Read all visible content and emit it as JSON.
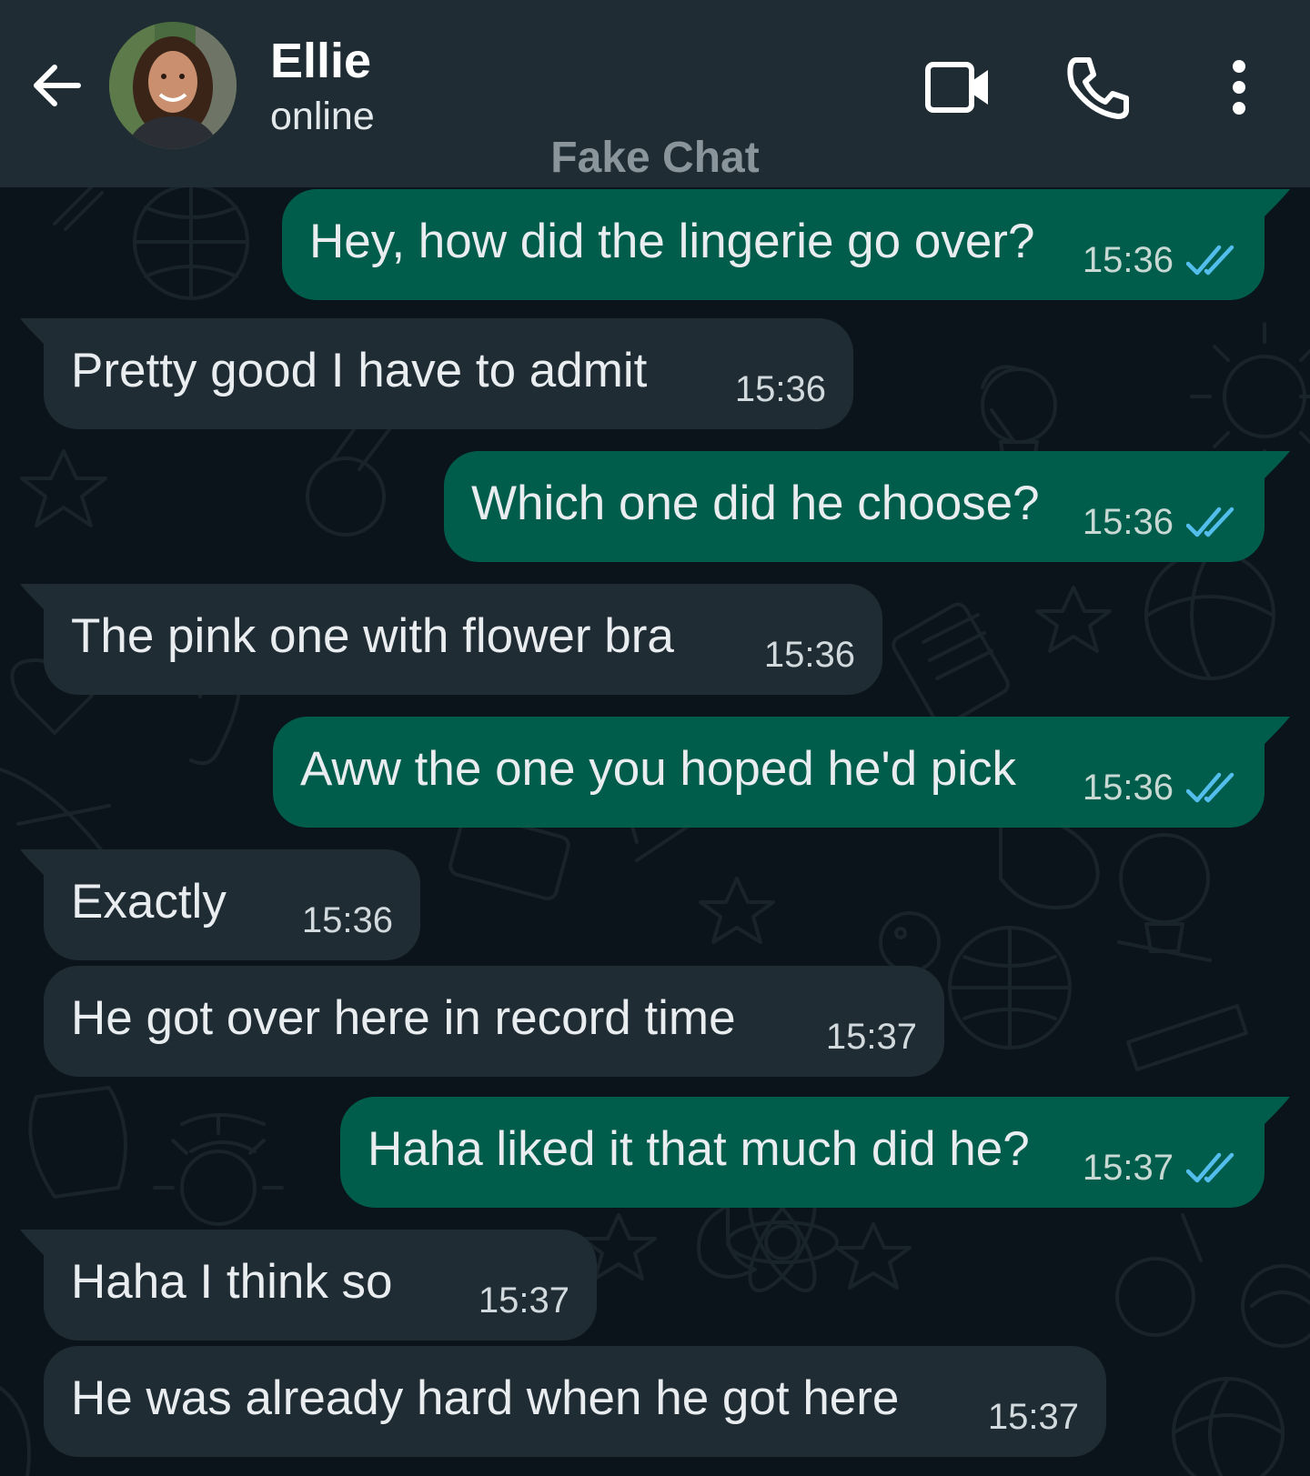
{
  "header": {
    "back_icon": "arrow-left-icon",
    "contact_name": "Ellie",
    "status": "online",
    "video_icon": "video-call-icon",
    "call_icon": "phone-icon",
    "menu_icon": "more-vertical-icon",
    "watermark": "Fake Chat"
  },
  "colors": {
    "header_bg": "#1f2c34",
    "chat_bg": "#0b141a",
    "outgoing_bubble": "#005c4b",
    "incoming_bubble": "#1f2c34",
    "read_ticks": "#53bdeb"
  },
  "messages": [
    {
      "direction": "outgoing",
      "text": "Hey, how did the lingerie go over?",
      "time": "15:36",
      "status": "read"
    },
    {
      "direction": "incoming",
      "text": "Pretty good I have to admit",
      "time": "15:36"
    },
    {
      "direction": "outgoing",
      "text": "Which one did he choose?",
      "time": "15:36",
      "status": "read"
    },
    {
      "direction": "incoming",
      "text": "The pink one with flower bra",
      "time": "15:36"
    },
    {
      "direction": "outgoing",
      "text": "Aww the one you hoped he'd pick",
      "time": "15:36",
      "status": "read"
    },
    {
      "direction": "incoming",
      "text": "Exactly",
      "time": "15:36"
    },
    {
      "direction": "incoming",
      "text": "He got over here in record time",
      "time": "15:37"
    },
    {
      "direction": "outgoing",
      "text": "Haha liked it that much did he?",
      "time": "15:37",
      "status": "read"
    },
    {
      "direction": "incoming",
      "text": "Haha I think so",
      "time": "15:37"
    },
    {
      "direction": "incoming",
      "text": "He was already hard when he got here",
      "time": "15:37"
    }
  ]
}
